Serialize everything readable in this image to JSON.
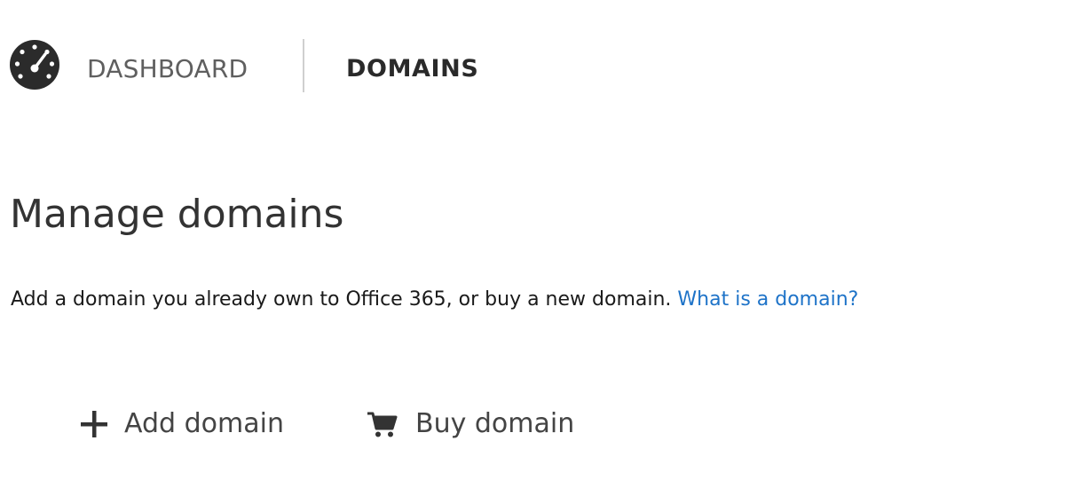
{
  "nav": {
    "icon": "gauge-icon",
    "dashboard_label": "DASHBOARD",
    "domains_label": "DOMAINS"
  },
  "main": {
    "title": "Manage domains",
    "description": "Add a domain you already own to Office 365, or buy a new domain.",
    "help_link": "What is a domain?"
  },
  "actions": {
    "add_domain": {
      "label": "Add domain",
      "icon": "plus-icon"
    },
    "buy_domain": {
      "label": "Buy domain",
      "icon": "cart-icon"
    }
  },
  "colors": {
    "link": "#1e73c8",
    "text": "#262626",
    "muted": "#5f5f5f"
  }
}
